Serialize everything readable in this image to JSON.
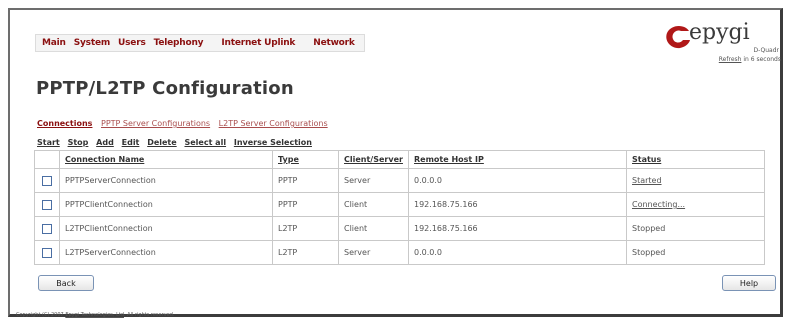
{
  "nav": {
    "items": [
      "Main",
      "System",
      "Users",
      "Telephony",
      "Internet Uplink",
      "Network"
    ]
  },
  "logo": {
    "brand": "epygi",
    "subtext": "D-Quadr",
    "refresh_link": "Refresh",
    "refresh_suffix": " in 6 seconds"
  },
  "page": {
    "title": "PPTP/L2TP Configuration"
  },
  "subtabs": [
    {
      "label": "Connections",
      "active": true
    },
    {
      "label": "PPTP Server Configurations",
      "active": false
    },
    {
      "label": "L2TP Server Configurations",
      "active": false
    }
  ],
  "actions": [
    "Start",
    "Stop",
    "Add",
    "Edit",
    "Delete",
    "Select all",
    "Inverse Selection"
  ],
  "table": {
    "columns": [
      "Connection Name",
      "Type",
      "Client/Server",
      "Remote Host IP",
      "Status"
    ],
    "rows": [
      {
        "name": "PPTPServerConnection",
        "type": "PPTP",
        "role": "Server",
        "remote_ip": "0.0.0.0",
        "status": "Started",
        "status_link": true
      },
      {
        "name": "PPTPClientConnection",
        "type": "PPTP",
        "role": "Client",
        "remote_ip": "192.168.75.166",
        "status": "Connecting...",
        "status_link": true
      },
      {
        "name": "L2TPClientConnection",
        "type": "L2TP",
        "role": "Client",
        "remote_ip": "192.168.75.166",
        "status": "Stopped",
        "status_link": false
      },
      {
        "name": "L2TPServerConnection",
        "type": "L2TP",
        "role": "Server",
        "remote_ip": "0.0.0.0",
        "status": "Stopped",
        "status_link": false
      }
    ]
  },
  "buttons": {
    "back": "Back",
    "help": "Help"
  },
  "footer": {
    "prefix": "Copyright (C) 2007 ",
    "company": "Epygi Technologies, Ltd",
    "suffix": ". All rights reserved."
  },
  "colors": {
    "nav_text": "#8b1010",
    "logo_mark": "#b01818",
    "border": "#c9c9c9"
  }
}
